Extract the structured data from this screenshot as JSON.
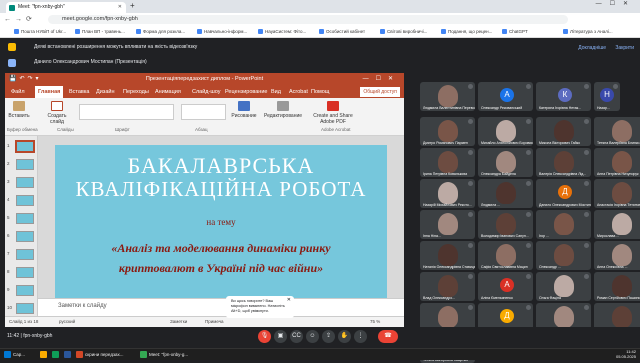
{
  "browser": {
    "tab_title": "Meet: \"fpn-xnby-gbh\"",
    "url": "meet.google.com/fpn-xnby-gbh",
    "bookmarks": [
      "Пошта НУБіП of Ukr...",
      "План ВП - травень...",
      "Форма для розкла...",
      "Навчально-інформ...",
      "НауаСистем: Фіто...",
      "Особистий кабінет",
      "Світові виробничі...",
      "Подання, що рецен...",
      "ChatGPT",
      "Література з Аналі..."
    ]
  },
  "banners": {
    "notice": "Деякі встановлені розширення можуть впливати на якість відеозв'язку",
    "notice_btn1": "Докладніше",
    "notice_btn2": "Закрити",
    "presenting": "Данило Олександрович Мостипан (Презентація)"
  },
  "ppt": {
    "window_title": "Презентаціяпередзахист диплом - PowerPoint",
    "tabs": [
      "Файл",
      "Главная",
      "Вставка",
      "Дизайн",
      "Переходы",
      "Анимация",
      "Слайд-шоу",
      "Рецензирование",
      "Вид",
      "Acrobat"
    ],
    "search": "Помощ",
    "share": "Общий доступ",
    "ribbon": {
      "paste": "Вставить",
      "create_slide": "Создать слайд",
      "font_group": "Шрифт",
      "paragraph_group": "Абзац",
      "drawing": "Рисование",
      "editing": "Редактирование",
      "acrobat": "Create and Share Adobe PDF",
      "clipboard_group": "Буфер обмена",
      "slides_group": "Слайды",
      "acrobat_group": "Adobe Acrobat"
    },
    "slide_numbers": [
      "1",
      "2",
      "3",
      "4",
      "5",
      "6",
      "7",
      "8",
      "9",
      "10"
    ],
    "slide": {
      "title_line1": "БАКАЛАВРСЬКА",
      "title_line2": "КВАЛІФІКАЦІЙНА РОБОТА",
      "subtitle": "на тему",
      "topic_line1": "«Аналіз та моделювання  динаміки ринку",
      "topic_line2": "криптовалют в Україні під час війни»"
    },
    "notes_placeholder": "Заметки к слайду",
    "status": {
      "slide_info": "Слайд 1 из 18",
      "language": "русский",
      "notes": "Заметки",
      "comments": "Примеча",
      "zoom": "75 %"
    }
  },
  "tooltip": {
    "text": "Ви щось говорите? Ваш мікрофон вимкнено. Натисніть Alt+D, щоб увімкнути."
  },
  "participants": [
    {
      "name": "Людмила Валентинівна Перевозова",
      "type": "photo"
    },
    {
      "name": "Олександр Рекованський",
      "avatar": "А",
      "color": "#1a73e8"
    },
    {
      "name": "Катерина Ігорівна Нетак...",
      "avatar": "К",
      "color": "#5c6bc0"
    },
    {
      "name": "Назар...",
      "avatar": "Н",
      "color": "#3949ab"
    },
    {
      "name": "Дмитро Романович Пармен",
      "type": "photo"
    },
    {
      "name": "Михайло Анатолійович Боровик",
      "type": "photo"
    },
    {
      "name": "Микола Вікторович Гайко",
      "type": "photo"
    },
    {
      "name": "Тетяна Валеріївна Блинко...",
      "type": "photo"
    },
    {
      "name": "Ірина Петрівна Ковалькова",
      "type": "photo"
    },
    {
      "name": "Олександра Байдела",
      "type": "photo"
    },
    {
      "name": "Валерія Олександрівна Лід...",
      "type": "photo"
    },
    {
      "name": "Анна Петрівна Ничупорук",
      "type": "photo"
    },
    {
      "name": "Назарій Михайлович Рекото...",
      "type": "photo"
    },
    {
      "name": "Людмила ...",
      "type": "photo"
    },
    {
      "name": "Данило Олександрович Мостипан",
      "avatar": "Д",
      "color": "#e8710a"
    },
    {
      "name": "Анастасія Ігорівна Тетянченко",
      "type": "photo"
    },
    {
      "name": "Інна Ніна...",
      "type": "photo"
    },
    {
      "name": "Володимир Іванович Сапун...",
      "type": "photo"
    },
    {
      "name": "Ігор ...",
      "type": "photo"
    },
    {
      "name": "Мирослава ...",
      "type": "photo"
    },
    {
      "name": "Наталія Олександрівна Ставицька",
      "type": "photo"
    },
    {
      "name": "Сафія Святославівна Мацин",
      "type": "photo"
    },
    {
      "name": "Олександр ...",
      "type": "photo"
    },
    {
      "name": "Анна Олексіївна ...",
      "type": "photo"
    },
    {
      "name": "Влад Олександро...",
      "type": "photo"
    },
    {
      "name": "Аліна Ємельяненко",
      "avatar": "А",
      "color": "#d93025"
    },
    {
      "name": "Ольга Фаціна",
      "type": "photo"
    },
    {
      "name": "Роман Сергійович Пашинок",
      "type": "photo"
    },
    {
      "name": "Артем Олександрович Пас...",
      "type": "photo"
    },
    {
      "name": "Денис Петрович ...",
      "avatar": "Д",
      "color": "#f9ab00"
    },
    {
      "name": "Данило Ростиславович ...",
      "type": "photo"
    },
    {
      "name": "Софія Ростиславівна Харлат...",
      "type": "photo"
    },
    {
      "name": "Тетяна Валеріївна Кащенко",
      "avatar": "Т",
      "color": "#d93025"
    }
  ],
  "meet": {
    "time": "11:42",
    "code": "fpn-xnby-gbh"
  },
  "taskbar": {
    "items": [
      "Сар...",
      "",
      "",
      "",
      "скрини передзах...",
      "Meet: \"fpn-xnby-g..."
    ],
    "clock_time": "11:42",
    "clock_date": "05.05.2025"
  }
}
